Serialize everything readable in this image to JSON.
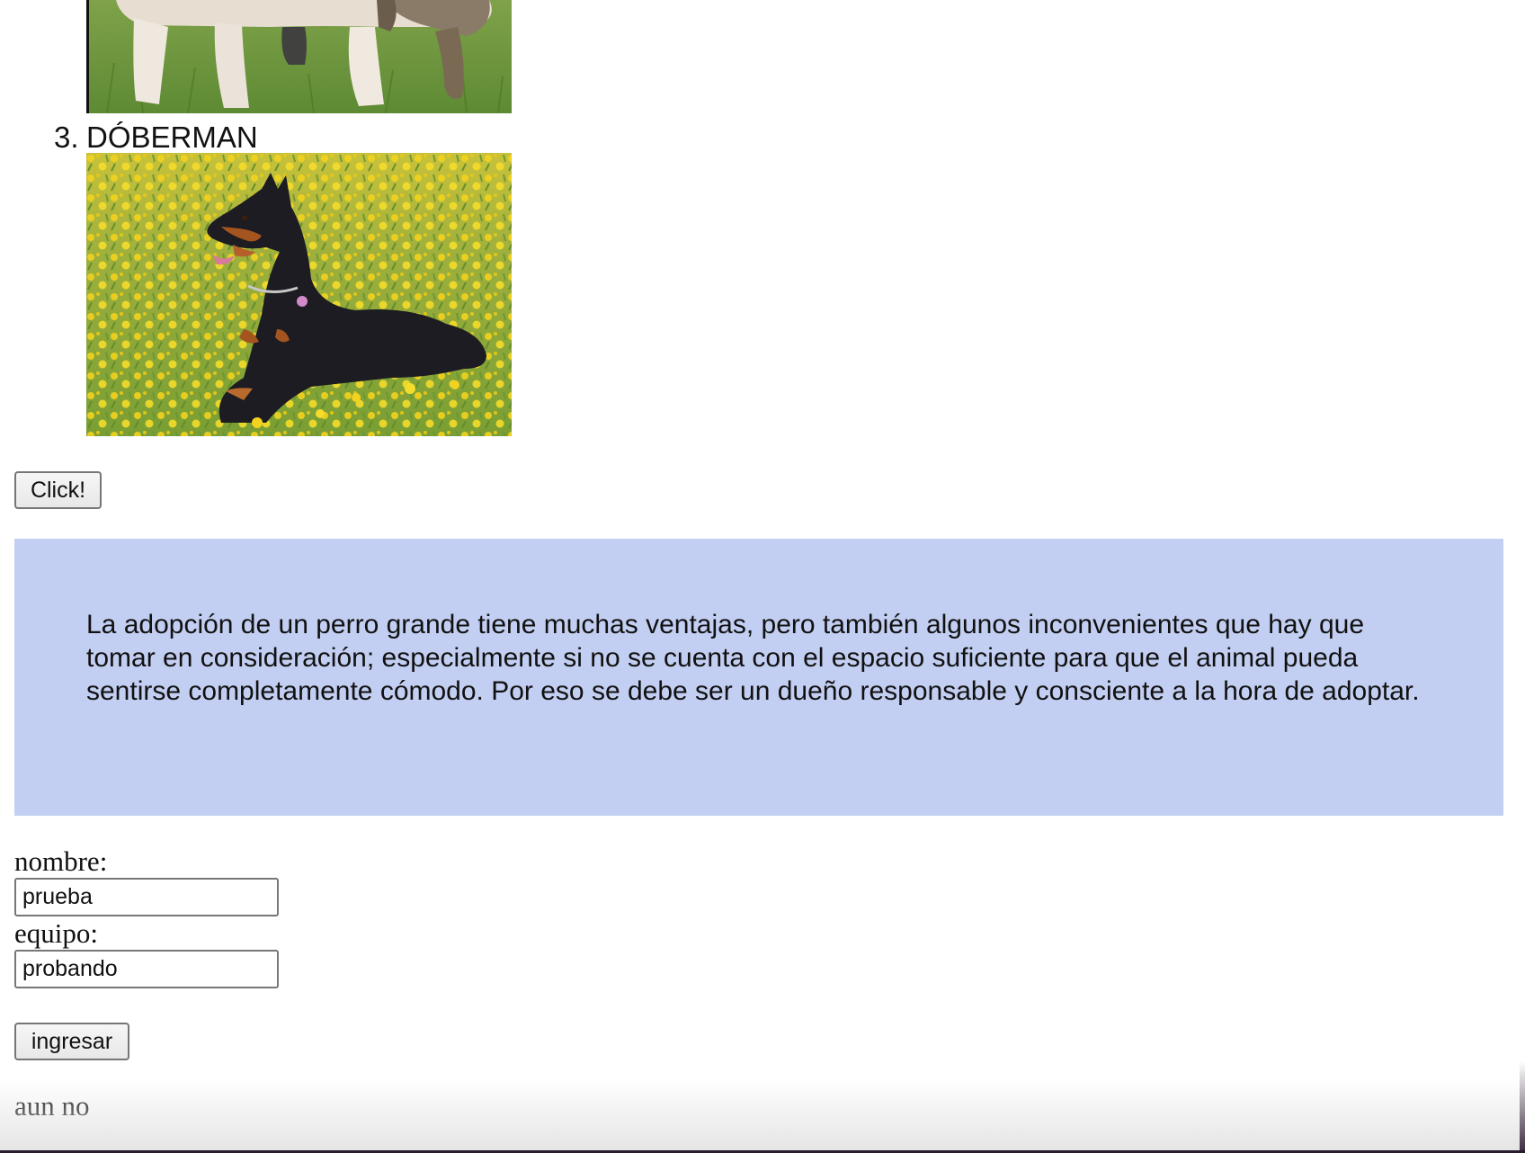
{
  "list": {
    "item3": {
      "number": "3.",
      "label": "DÓBERMAN"
    }
  },
  "images": {
    "previous_dog": "dog-photo-partial",
    "doberman": "doberman-photo"
  },
  "buttons": {
    "click_label": "Click!",
    "submit_label": "ingresar"
  },
  "info": {
    "text": "La adopción de un perro grande tiene muchas ventajas, pero también algunos inconvenientes que hay que tomar en consideración; especialmente si no se cuenta con el espacio suficiente para que el animal pueda sentirse completamente cómodo. Por eso se debe ser un dueño responsable y consciente a la hora de adoptar.",
    "background_color": "#c3cff2"
  },
  "form": {
    "nombre_label": "nombre:",
    "nombre_value": "prueba",
    "equipo_label": "equipo:",
    "equipo_value": "probando"
  },
  "status": {
    "text": "aun no"
  }
}
